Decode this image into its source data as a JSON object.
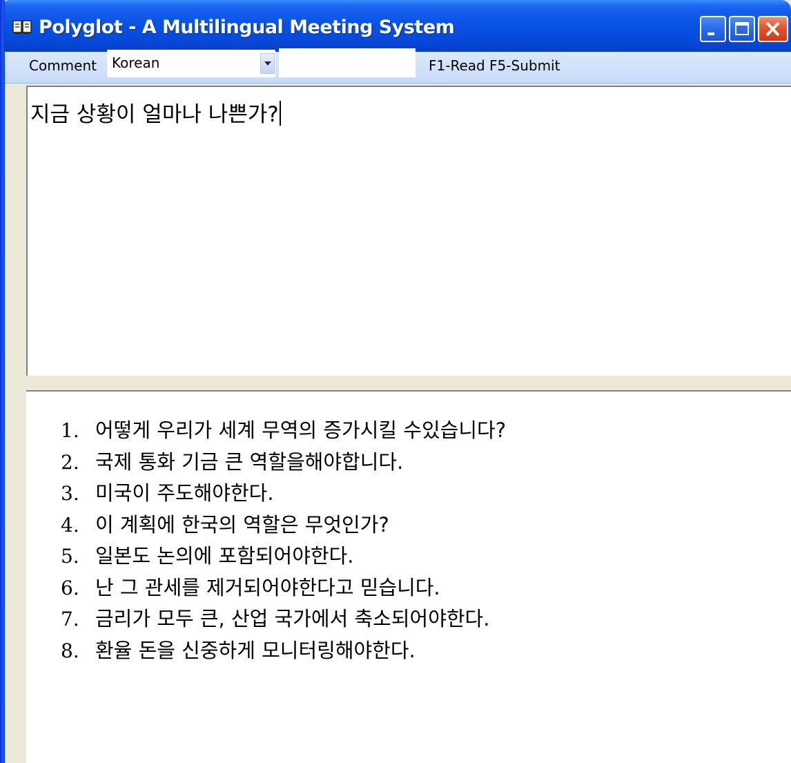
{
  "window": {
    "title": "Polyglot - A Multilingual Meeting System",
    "title_bar_color": "#0a52e6",
    "close_button_color": "#e0502a"
  },
  "toolbar": {
    "comment_label": "Comment",
    "language_select": {
      "selected": "Korean"
    },
    "extra_input_value": "",
    "shortcuts": "F1-Read  F5-Submit"
  },
  "editor": {
    "value": "지금 상황이 얼마나 나쁜가?"
  },
  "history": {
    "items": [
      {
        "num": "1.",
        "text": "어떻게 우리가 세계 무역의 증가시킬 수있습니다?"
      },
      {
        "num": "2.",
        "text": "국제 통화 기금 큰 역할을해야합니다."
      },
      {
        "num": "3.",
        "text": "미국이 주도해야한다."
      },
      {
        "num": "4.",
        "text": "이 계획에 한국의 역할은 무엇인가?"
      },
      {
        "num": "5.",
        "text": "일본도 논의에 포함되어야한다."
      },
      {
        "num": "6.",
        "text": "난 그 관세를 제거되어야한다고 믿습니다."
      },
      {
        "num": "7.",
        "text": "금리가 모두 큰, 산업 국가에서 축소되어야한다."
      },
      {
        "num": "8.",
        "text": "환율 돈을 신중하게 모니터링해야한다."
      }
    ]
  }
}
